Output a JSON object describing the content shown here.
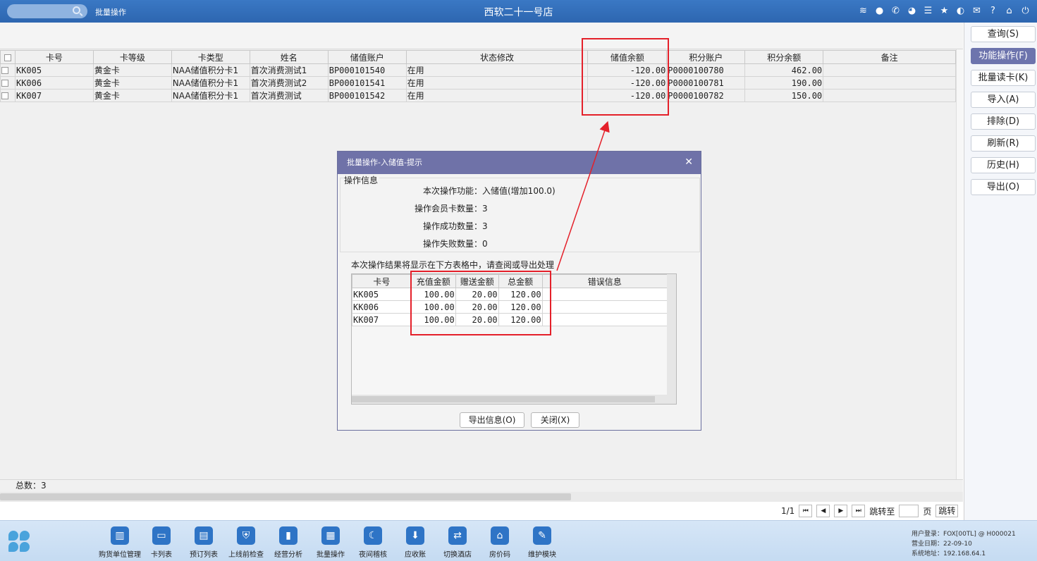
{
  "topbar": {
    "module_title": "批量操作",
    "store_name": "西软二十一号店",
    "icons": [
      "wifi-icon",
      "chat-icon",
      "phone-icon",
      "palette-icon",
      "menu-icon",
      "star-icon",
      "theme-icon",
      "mail-icon",
      "help-icon",
      "home-icon",
      "power-icon"
    ]
  },
  "grid": {
    "headers": [
      "卡号",
      "卡等级",
      "卡类型",
      "姓名",
      "储值账户",
      "状态修改",
      "储值余额",
      "积分账户",
      "积分余额",
      "备注"
    ],
    "rows": [
      [
        "KK005",
        "黄金卡",
        "NAA储值积分卡1",
        "首次消费测试1",
        "BP000101540",
        "在用",
        "-120.00",
        "P0000100780",
        "462.00",
        ""
      ],
      [
        "KK006",
        "黄金卡",
        "NAA储值积分卡1",
        "首次消费测试2",
        "BP000101541",
        "在用",
        "-120.00",
        "P0000100781",
        "190.00",
        ""
      ],
      [
        "KK007",
        "黄金卡",
        "NAA储值积分卡1",
        "首次消费测试",
        "BP000101542",
        "在用",
        "-120.00",
        "P0000100782",
        "150.00",
        ""
      ]
    ]
  },
  "footer": {
    "total": "总数：3"
  },
  "pager": {
    "page": "1/1",
    "jump_label": "跳转至",
    "page_unit": "页",
    "jump_button": "跳转"
  },
  "right_panel": {
    "buttons": [
      "查询(S)",
      "功能操作(F)",
      "批量读卡(K)",
      "导入(A)",
      "排除(D)",
      "刷新(R)",
      "历史(H)",
      "导出(O)"
    ]
  },
  "dialog": {
    "title": "批量操作-入储值-提示",
    "info_legend": "操作信息",
    "info_rows": [
      "本次操作功能：入储值(增加100.0)",
      "操作会员卡数量：3",
      "操作成功数量：3",
      "操作失败数量：0"
    ],
    "result_note": "本次操作结果将显示在下方表格中，请查阅或导出处理",
    "result_headers": [
      "卡号",
      "充值金额",
      "赠送金额",
      "总金额",
      "错误信息"
    ],
    "result_rows": [
      [
        "KK005",
        "100.00",
        "20.00",
        "120.00",
        ""
      ],
      [
        "KK006",
        "100.00",
        "20.00",
        "120.00",
        ""
      ],
      [
        "KK007",
        "100.00",
        "20.00",
        "120.00",
        ""
      ]
    ],
    "export_button": "导出信息(O)",
    "close_button": "关闭(X)"
  },
  "bottombar": {
    "nav": [
      "购货单位管理",
      "卡列表",
      "预订列表",
      "上线前检查",
      "经营分析",
      "批量操作",
      "夜间稽核",
      "应收账",
      "切换酒店",
      "房价码",
      "维护模块"
    ],
    "sys_info": [
      "用户登录：FOX[00TL] @ H000021",
      "营业日期：22-09-10",
      "系统地址：192.168.64.1"
    ]
  },
  "colors": {
    "accent": "#2d66b0",
    "dialog_title": "#6f72a8",
    "annotation": "#e4202a"
  }
}
